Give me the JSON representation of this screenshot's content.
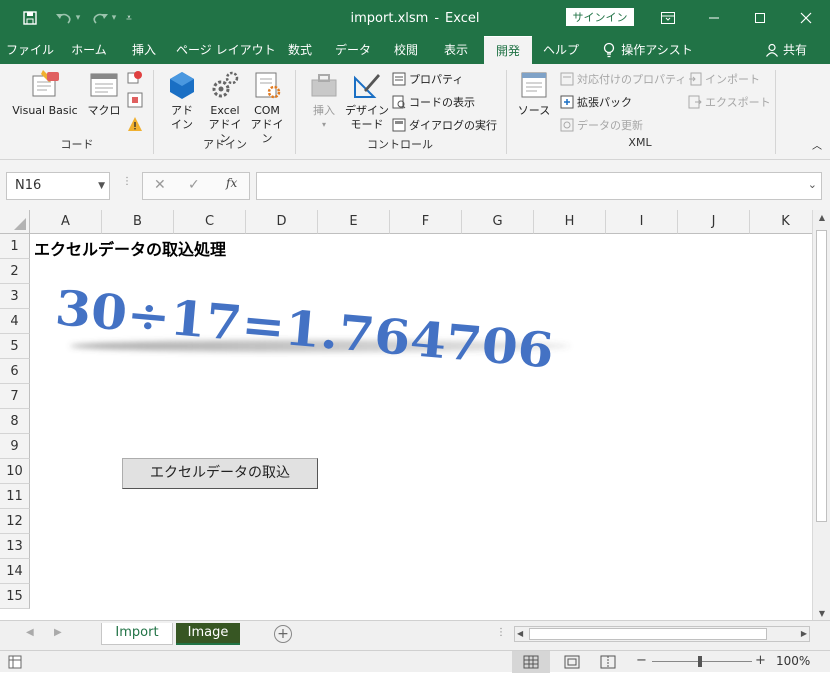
{
  "title": {
    "file": "import.xlsm",
    "sep": "-",
    "app": "Excel",
    "signin": "サインイン"
  },
  "tabs": [
    {
      "label": "ファイル"
    },
    {
      "label": "ホーム"
    },
    {
      "label": "挿入"
    },
    {
      "label": "ページ レイアウト"
    },
    {
      "label": "数式"
    },
    {
      "label": "データ"
    },
    {
      "label": "校閲"
    },
    {
      "label": "表示"
    },
    {
      "label": "開発",
      "active": true
    },
    {
      "label": "ヘルプ"
    }
  ],
  "tell_me": "操作アシスト",
  "share": "共有",
  "ribbon": {
    "code": {
      "group": "コード",
      "visual_basic": "Visual Basic",
      "macro": "マクロ"
    },
    "addin": {
      "group": "アドイン",
      "addin_l1": "アド",
      "addin_l2": "イン",
      "excel_l1": "Excel",
      "excel_l2": "アドイン",
      "com_l1": "COM",
      "com_l2": "アドイン"
    },
    "control": {
      "group": "コントロール",
      "insert": "挿入",
      "design_l1": "デザイン",
      "design_l2": "モード",
      "properties": "プロパティ",
      "view_code": "コードの表示",
      "run_dialog": "ダイアログの実行"
    },
    "xml": {
      "group": "XML",
      "source": "ソース",
      "map_props": "対応付けのプロパティ",
      "expansion": "拡張パック",
      "refresh": "データの更新",
      "import": "インポート",
      "export": "エクスポート"
    }
  },
  "formula_bar": {
    "name_box": "N16",
    "fx": "fx",
    "value": ""
  },
  "columns": [
    "A",
    "B",
    "C",
    "D",
    "E",
    "F",
    "G",
    "H",
    "I",
    "J",
    "K"
  ],
  "rows": [
    "1",
    "2",
    "3",
    "4",
    "5",
    "6",
    "7",
    "8",
    "9",
    "10",
    "11",
    "12",
    "13",
    "14",
    "15"
  ],
  "cells": {
    "A1": "エクセルデータの取込処理"
  },
  "wordart": {
    "text": "30÷17=1.764706",
    "color": "#4472c4"
  },
  "button": {
    "label": "エクセルデータの取込"
  },
  "sheets": [
    {
      "name": "Import",
      "active": false
    },
    {
      "name": "Image",
      "active": true
    }
  ],
  "status": {
    "zoom": "100%",
    "minus": "−",
    "plus": "+"
  }
}
